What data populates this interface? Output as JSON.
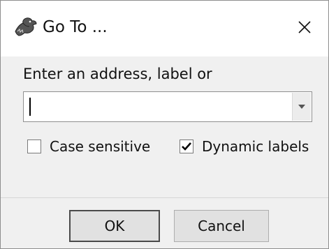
{
  "dialog": {
    "title": "Go To ...",
    "prompt": "Enter an address, label or",
    "address_input": {
      "value": "",
      "placeholder": ""
    },
    "options": {
      "case_sensitive": {
        "label": "Case sensitive",
        "checked": false
      },
      "dynamic_labels": {
        "label": "Dynamic labels",
        "checked": true
      }
    },
    "buttons": {
      "ok_label": "OK",
      "cancel_label": "Cancel"
    }
  },
  "icons": {
    "title": "dragon-icon",
    "close": "close-icon",
    "dropdown": "chevron-down-icon",
    "checkmark": "checkmark-icon"
  }
}
